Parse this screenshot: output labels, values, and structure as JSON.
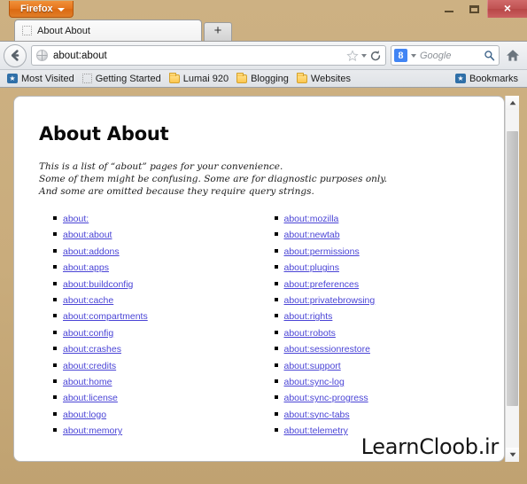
{
  "window": {
    "app_button_label": "Firefox",
    "controls": {
      "minimize": "–",
      "maximize": "❐",
      "close": "×"
    }
  },
  "tabs": [
    {
      "title": "About About",
      "favicon": "dotted-placeholder-icon",
      "active": true
    }
  ],
  "new_tab_label": "+",
  "navbar": {
    "back_label": "Back",
    "url_value": "about:about",
    "url_favicon": "globe-icon",
    "bookmark_star": "☆",
    "dropmarker": "▾",
    "reload": "⟳",
    "home": "home-icon"
  },
  "search": {
    "engine_letter": "8",
    "engine_name": "Google",
    "placeholder": "Google",
    "value": ""
  },
  "bookmarks": {
    "items": [
      {
        "label": "Most Visited",
        "icon": "most-visited-icon"
      },
      {
        "label": "Getting Started",
        "icon": "dotted-placeholder-icon"
      },
      {
        "label": "Lumai 920",
        "icon": "folder-icon"
      },
      {
        "label": "Blogging",
        "icon": "folder-icon"
      },
      {
        "label": "Websites",
        "icon": "folder-icon"
      }
    ],
    "right_label": "Bookmarks",
    "right_icon": "bookmarks-star-icon"
  },
  "page": {
    "title": "About About",
    "description_lines": [
      "This is a list of “about” pages for your convenience.",
      "Some of them might be confusing. Some are for diagnostic purposes only.",
      "And some are omitted because they require query strings."
    ],
    "columns": [
      {
        "links": [
          "about:",
          "about:about",
          "about:addons",
          "about:apps",
          "about:buildconfig",
          "about:cache",
          "about:compartments",
          "about:config",
          "about:crashes",
          "about:credits",
          "about:home",
          "about:license",
          "about:logo",
          "about:memory"
        ]
      },
      {
        "links": [
          "about:mozilla",
          "about:newtab",
          "about:permissions",
          "about:plugins",
          "about:preferences",
          "about:privatebrowsing",
          "about:rights",
          "about:robots",
          "about:sessionrestore",
          "about:support",
          "about:sync-log",
          "about:sync-progress",
          "about:sync-tabs",
          "about:telemetry"
        ]
      }
    ],
    "watermark": "LearnCloob.ir"
  },
  "colors": {
    "frame": "#c9ac7c",
    "firefox_orange": "#e7761d",
    "close_red": "#c05252",
    "link": "#4a44d6",
    "search_engine_blue": "#4285f4"
  }
}
